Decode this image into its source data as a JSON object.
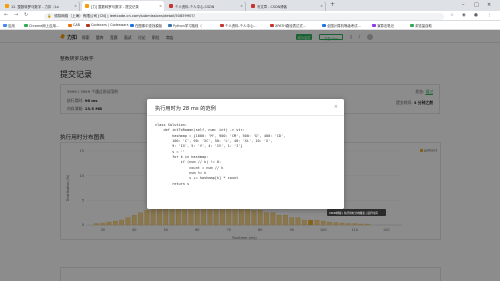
{
  "browser": {
    "tabs": [
      {
        "label": "12. 整数转罗马数字 - 力扣（Lo",
        "fav_color": "#f59e0b",
        "active": false
      },
      {
        "label": "[力] 整数转罗马数字 - 提交记录",
        "fav_color": "#f59e0b",
        "active": true
      },
      {
        "label": "个人资料-个人中心-CSDN",
        "fav_color": "#c8332b",
        "active": false
      },
      {
        "label": "写文章 - CSDN博客",
        "fav_color": "#c8332b",
        "active": false
      }
    ],
    "new_tab": "+",
    "url_prefix": "领扣网络（上海）有限公司 [CN] | ",
    "url": "leetcode-cn.com/submissions/detail/50859907/",
    "bookmarks": [
      {
        "label": "应用",
        "color": "#4285f4"
      },
      {
        "label": "Chrome网上应用...",
        "color": "#34a853"
      },
      {
        "label": "CAB",
        "color": "#e8710a"
      },
      {
        "label": "Codecars | Codeswars",
        "color": "#b1361e"
      },
      {
        "label": "在图像中查找模板",
        "color": "#1a73e8"
      },
      {
        "label": "Python学习路线（",
        "color": "#3776ab"
      },
      {
        "label": "个人资料-个人中心...",
        "color": "#c8332b"
      },
      {
        "label": "XPATH路径表达式...",
        "color": "#c8332b"
      },
      {
        "label": "全国计算机等级考试...",
        "color": "#1a73e8"
      },
      {
        "label": "演算法笔记",
        "color": "#9334e6"
      },
      {
        "label": "浏览量自助",
        "color": "#34a853"
      }
    ]
  },
  "nav": {
    "logo": "力扣",
    "links": [
      "探索",
      "题库",
      "竞赛",
      "面试",
      "讨论",
      "职位",
      "商店"
    ],
    "vip": "成为会员",
    "download": "下载 App"
  },
  "page": {
    "breadcrumb": "整数转罗马数字",
    "title": "提交记录",
    "summary": {
      "tests": "3999 / 3999 个通过测试用例",
      "runtime_label": "执行用时:",
      "runtime": "96 ms",
      "memory_label": "内存消耗:",
      "memory": "13.5 MB",
      "status_label": "状态:",
      "status": "通过",
      "submitted_label": "提交时间:",
      "submitted": "3 分钟之前"
    },
    "chart_title": "执行用时分布图表"
  },
  "chart_data": {
    "type": "bar",
    "ylabel": "Distribution (%)",
    "xlabel": "Runtime (ms)",
    "legend": [
      "python3"
    ],
    "yticks": [
      0,
      5,
      10,
      15
    ],
    "ylim": [
      0,
      15
    ],
    "xticks": [
      30,
      40,
      50,
      60,
      70,
      80,
      90,
      100,
      110,
      120
    ],
    "xlim": [
      25,
      125
    ],
    "x": [
      28,
      30,
      32,
      34,
      36,
      38,
      40,
      42,
      44,
      46,
      48,
      50,
      52,
      54,
      56,
      58,
      60,
      62,
      64,
      66,
      68,
      70,
      72,
      74,
      76,
      78,
      80,
      82,
      84,
      86,
      88,
      90,
      92,
      94,
      96,
      98,
      100,
      102,
      104,
      106,
      108,
      110,
      112,
      114
    ],
    "values": [
      0.3,
      0.4,
      0.6,
      0.8,
      1.0,
      1.5,
      2.0,
      2.5,
      3.0,
      3.5,
      4.0,
      4.5,
      5.0,
      5.5,
      6.0,
      6.5,
      7.0,
      6.5,
      6.0,
      5.5,
      5.0,
      4.5,
      4.0,
      3.5,
      3.5,
      3.0,
      3.0,
      2.5,
      2.5,
      2.0,
      2.0,
      1.5,
      1.5,
      1.0,
      1.0,
      1.0,
      0.8,
      0.6,
      0.5,
      0.4,
      0.3,
      0.3,
      0.2,
      0.2
    ],
    "highlight_x": 96
  },
  "modal": {
    "title": "执行用时为 28 ms 的范例",
    "close": "×",
    "code": [
      "class Solution:",
      "    def intToRoman(self, num: int) -> str:",
      "        hashmap = {1000: 'M', 900: 'CM', 500: 'D', 400: 'CD',",
      "        100: 'C', 90: 'XC', 50: 'L', 40: 'XL', 10: 'X',",
      "        9: 'IX', 5: 'V', 4: 'IV', 1: 'I'}",
      "        s = ''",
      "        for k in hashmap:",
      "            if (num // k) != 0:",
      "                count = num // k",
      "                num %= k",
      "                s += hashmap[k] * count",
      "        return s"
    ]
  },
  "tooltip": "CSDN博客 | 执行用时分布图表 | 运行时间"
}
